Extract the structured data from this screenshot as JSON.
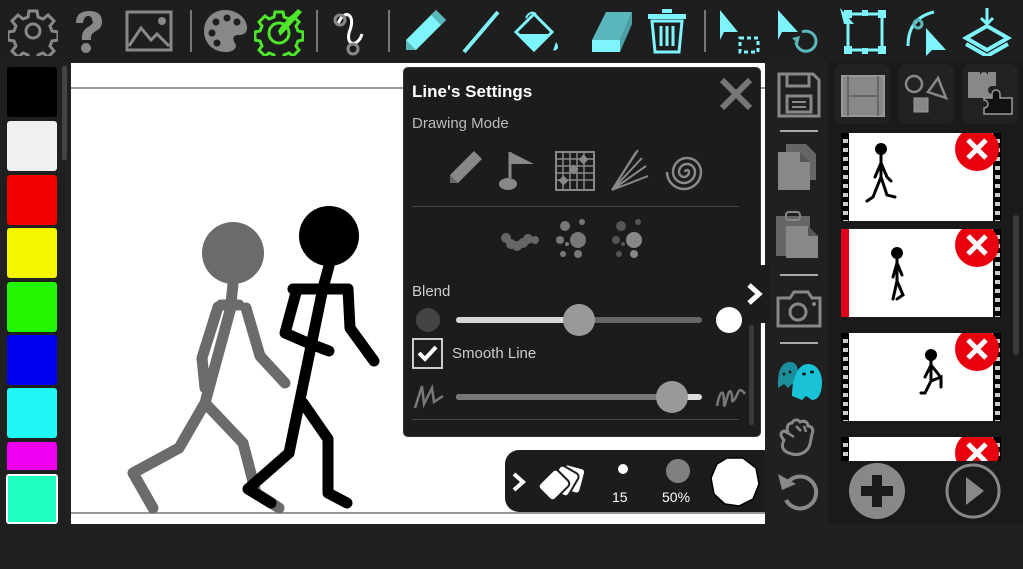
{
  "toolbar": {
    "left_tools": [
      {
        "name": "settings",
        "icon": "gear-icon"
      },
      {
        "name": "help",
        "icon": "question-icon"
      },
      {
        "name": "background image",
        "icon": "image-icon"
      },
      {
        "name": "palette",
        "icon": "palette-icon"
      },
      {
        "name": "tool settings",
        "icon": "brush-gear-icon",
        "active": true
      },
      {
        "name": "curve",
        "icon": "curve-icon"
      }
    ],
    "draw_tools": [
      {
        "name": "pencil",
        "icon": "pencil-icon"
      },
      {
        "name": "line",
        "icon": "line-icon",
        "active": true
      },
      {
        "name": "fill",
        "icon": "bucket-icon"
      },
      {
        "name": "eraser",
        "icon": "eraser-icon"
      },
      {
        "name": "delete",
        "icon": "trash-icon"
      }
    ],
    "select_tools": [
      {
        "name": "select area",
        "icon": "select-area-icon"
      },
      {
        "name": "rotate select",
        "icon": "select-rotate-icon"
      },
      {
        "name": "transform",
        "icon": "transform-icon"
      },
      {
        "name": "bend",
        "icon": "bend-icon"
      },
      {
        "name": "layer",
        "icon": "layer-down-icon"
      }
    ]
  },
  "palette": {
    "colors": [
      "#000000",
      "#f0f0f0",
      "#f00000",
      "#f5f500",
      "#22f500",
      "#0000f0",
      "#22f5f5",
      "#f000f0",
      "#20ffc0"
    ],
    "selected_index": 8
  },
  "settings_panel": {
    "title": "Line's Settings",
    "drawing_mode_label": "Drawing Mode",
    "modes": [
      "pencil-mode",
      "flag-mode",
      "grid-mode",
      "rays-mode",
      "spiral-mode"
    ],
    "brushes": [
      "dots-trail",
      "scatter-dots",
      "scatter-dots-faded"
    ],
    "blend_label": "Blend",
    "blend_value": 0.5,
    "smooth_line_label": "Smooth Line",
    "smooth_line_checked": true,
    "smoothness_value": 0.88
  },
  "brush_bar": {
    "size": "15",
    "opacity": "50%",
    "opacity_color": "#808080",
    "color": "#ffffff"
  },
  "side_tools": [
    {
      "name": "save",
      "icon": "floppy-icon"
    },
    {
      "name": "copy",
      "icon": "copy-icon"
    },
    {
      "name": "paste",
      "icon": "paste-icon"
    },
    {
      "name": "snapshot",
      "icon": "camera-icon"
    },
    {
      "name": "onion skin",
      "icon": "ghost-icon",
      "active": true
    },
    {
      "name": "pan",
      "icon": "hand-icon"
    },
    {
      "name": "undo",
      "icon": "undo-icon"
    }
  ],
  "frames_panel": {
    "tabs": [
      "frames-tab",
      "shapes-tab",
      "puzzle-tab"
    ],
    "frames": [
      {
        "index": 1,
        "selected": false
      },
      {
        "index": 2,
        "selected": true
      },
      {
        "index": 3,
        "selected": false
      },
      {
        "index": 4,
        "selected": false
      }
    ],
    "add_label": "add-frame",
    "play_label": "play"
  }
}
